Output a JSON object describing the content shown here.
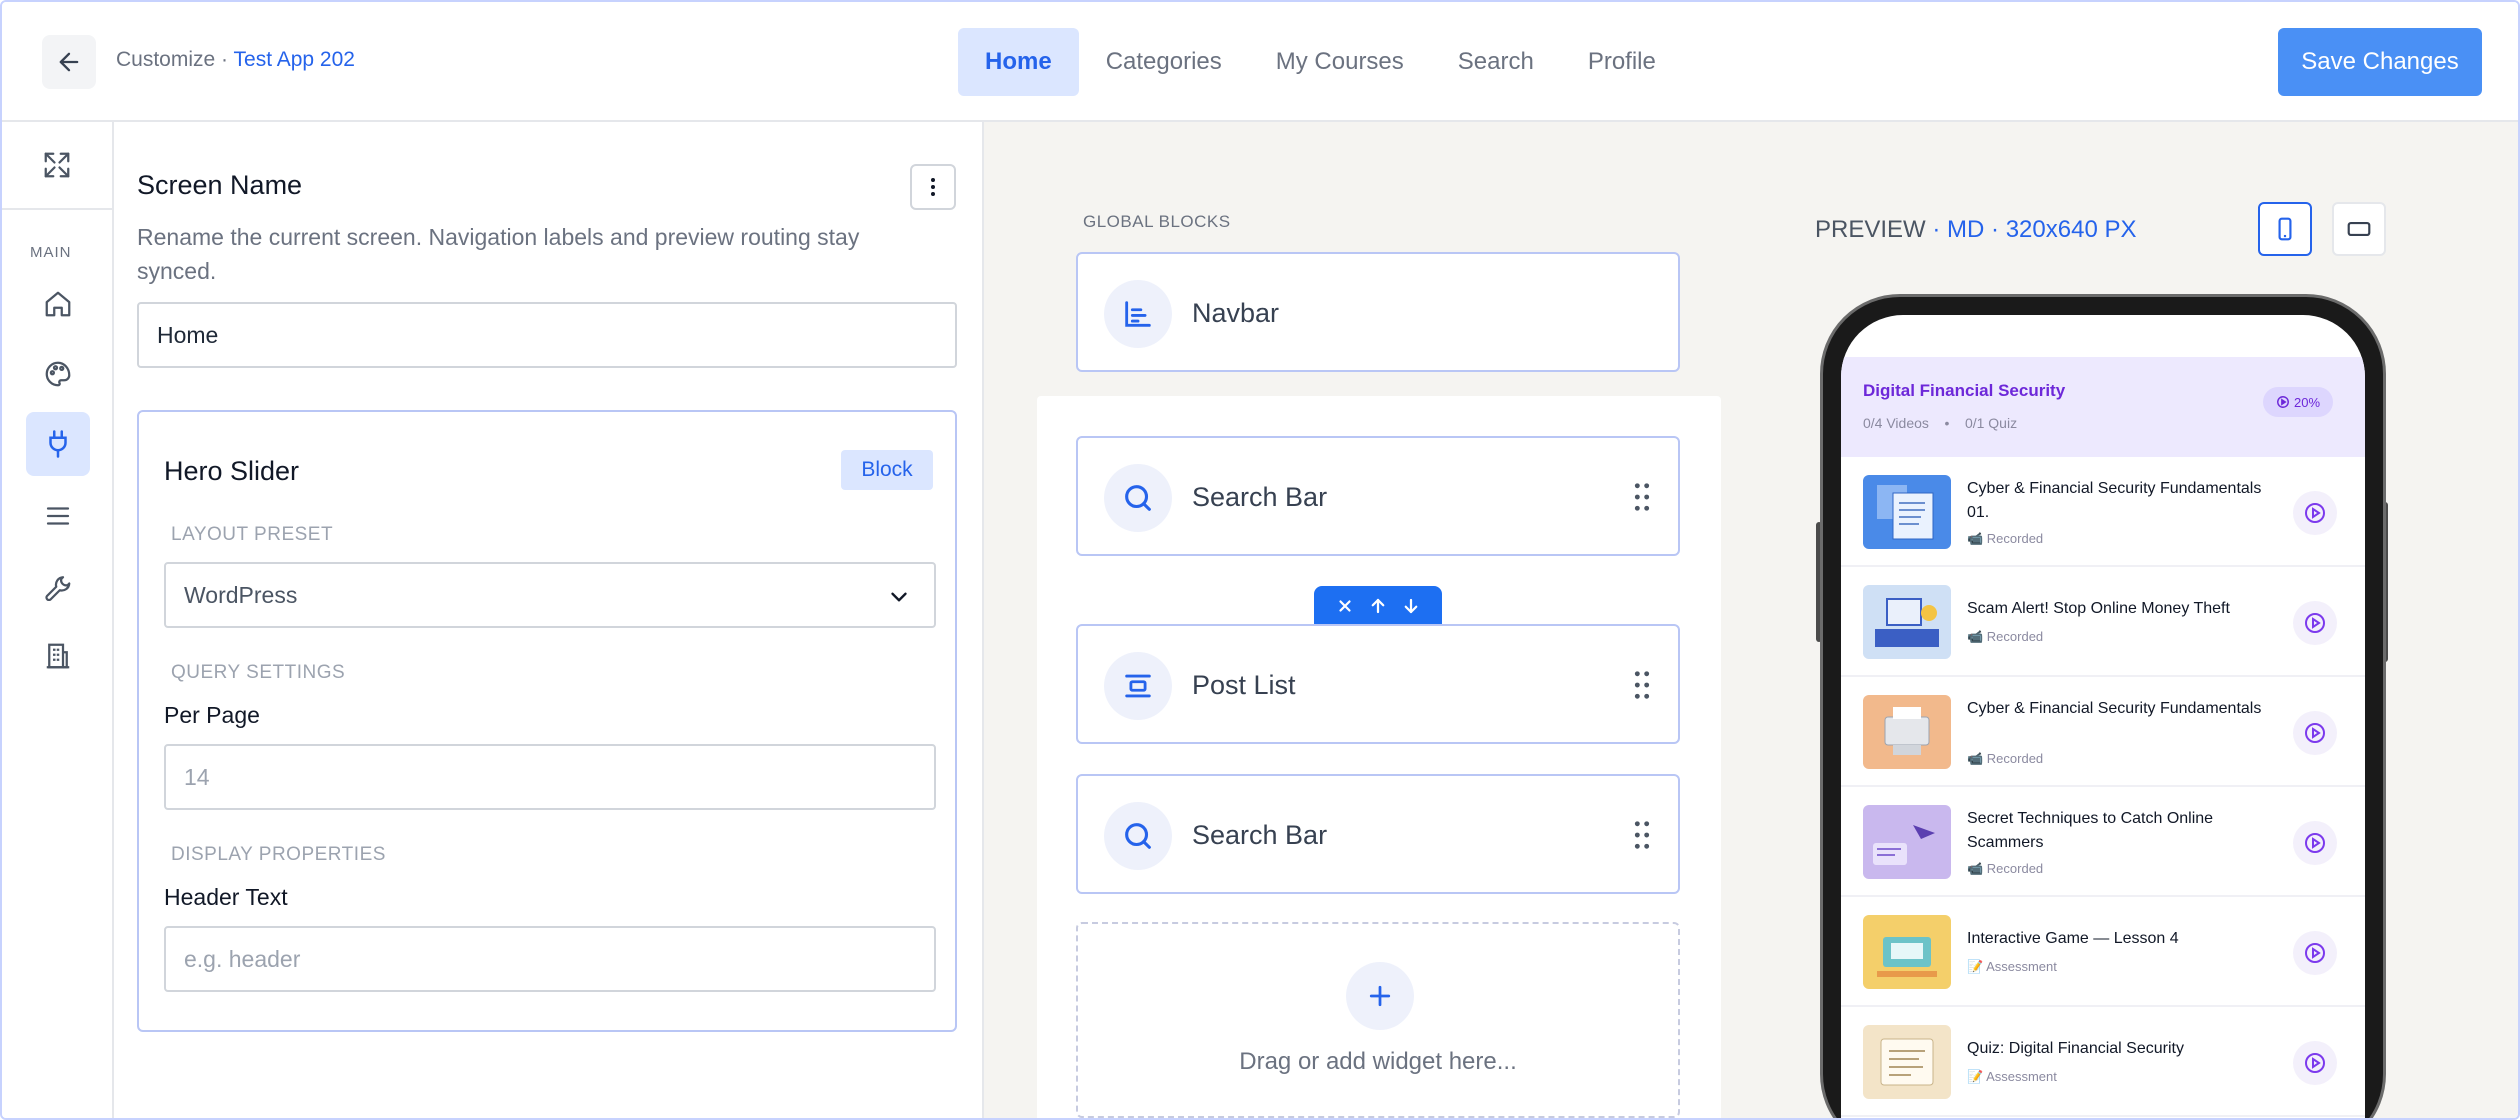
{
  "header": {
    "breadcrumb_prefix": "Customize",
    "breadcrumb_separator": "·",
    "app_name": "Test App 202",
    "tabs": [
      {
        "label": "Home",
        "active": true
      },
      {
        "label": "Categories",
        "active": false
      },
      {
        "label": "My Courses",
        "active": false
      },
      {
        "label": "Search",
        "active": false
      },
      {
        "label": "Profile",
        "active": false
      }
    ],
    "save_label": "Save Changes"
  },
  "rail": {
    "section_label": "MAIN",
    "items": [
      {
        "icon": "home-icon",
        "active": false
      },
      {
        "icon": "palette-icon",
        "active": false
      },
      {
        "icon": "plug-icon",
        "active": true
      },
      {
        "icon": "menu-icon",
        "active": false
      },
      {
        "icon": "wrench-icon",
        "active": false
      },
      {
        "icon": "building-icon",
        "active": false
      }
    ]
  },
  "settings": {
    "screen_name_title": "Screen Name",
    "screen_name_desc": "Rename the current screen. Navigation labels and preview routing stay synced.",
    "screen_name_value": "Home",
    "hero": {
      "title": "Hero Slider",
      "badge": "Block",
      "layout_section": "LAYOUT PRESET",
      "layout_value": "WordPress",
      "query_section": "QUERY SETTINGS",
      "per_page_label": "Per Page",
      "per_page_placeholder": "14",
      "display_section": "DISPLAY PROPERTIES",
      "header_text_label": "Header Text",
      "header_text_placeholder": "e.g. header"
    }
  },
  "canvas": {
    "global_blocks_label": "GLOBAL BLOCKS",
    "global_blocks": [
      {
        "name": "Navbar",
        "icon": "navbar-icon"
      }
    ],
    "blocks": [
      {
        "name": "Search Bar",
        "icon": "search-icon"
      },
      {
        "name": "Post List",
        "icon": "post-list-icon"
      },
      {
        "name": "Search Bar",
        "icon": "search-icon"
      }
    ],
    "drop_zone_text": "Drag or add widget here..."
  },
  "preview": {
    "label": "PREVIEW",
    "separator": "·",
    "size": "MD",
    "dims": "320x640 PX",
    "device_modes": [
      {
        "icon": "phone-portrait-icon",
        "active": true
      },
      {
        "icon": "tablet-landscape-icon",
        "active": false
      }
    ],
    "course": {
      "title": "Digital Financial Security",
      "videos": "0/4 Videos",
      "meta_sep": "•",
      "quiz": "0/1 Quiz",
      "progress_label": "20%",
      "progress": 0.2
    },
    "lessons": [
      {
        "title": "Cyber & Financial Security Fundamentals 01.",
        "tag": "📹 Recorded",
        "thumb": "#4a8ae8"
      },
      {
        "title": "Scam Alert! Stop Online Money Theft",
        "tag": "📹 Recorded",
        "thumb": "#cfe0f5"
      },
      {
        "title": "Cyber & Financial Security Fundamentals",
        "tag": "📹 Recorded",
        "thumb": "#f2b98c"
      },
      {
        "title": "Secret Techniques to Catch Online Scammers",
        "tag": "📹 Recorded",
        "thumb": "#c9b8ee"
      },
      {
        "title": "Interactive Game — Lesson 4",
        "tag": "📝 Assessment",
        "thumb": "#f4cf6a"
      },
      {
        "title": "Quiz: Digital Financial Security",
        "tag": "📝 Assessment",
        "thumb": "#f3e4c8"
      }
    ]
  },
  "colors": {
    "accent": "#2563eb",
    "save_button": "#4a90f5",
    "course_purple": "#6d28d9"
  }
}
